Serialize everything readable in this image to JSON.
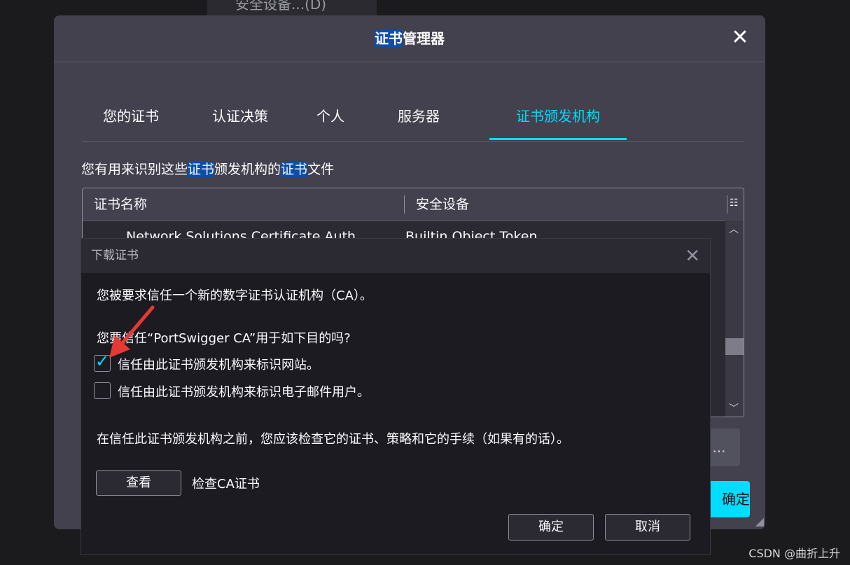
{
  "background": {
    "partial_menu_text": "安全设备...(D)"
  },
  "cert_manager": {
    "title_highlight": "证书",
    "title_rest": "管理器",
    "close_glyph": "✕",
    "tabs": [
      {
        "label": "您的证书"
      },
      {
        "label": "认证决策"
      },
      {
        "label": "个人"
      },
      {
        "label": "服务器"
      },
      {
        "label": "证书颁发机构",
        "active": true
      }
    ],
    "description": {
      "p1": "您有用来识别这些",
      "hl1": "证书",
      "p2": "颁发机构的",
      "hl2": "证书",
      "p3": "文件"
    },
    "columns": [
      "证书名称",
      "安全设备"
    ],
    "first_row": {
      "name": "Network Solutions Certificate Auth...",
      "device": "Builtin Object Token"
    },
    "partial_button_text": "...",
    "ok_partial": "确定"
  },
  "download_dialog": {
    "title": "下载证书",
    "close_glyph": "✕",
    "message": "您被要求信任一个新的数字证书认证机构（CA）。",
    "question": "您要信任“PortSwigger CA”用于如下目的吗?",
    "options": [
      {
        "label": "信任由此证书颁发机构来标识网站。",
        "checked": true
      },
      {
        "label": "信任由此证书颁发机构来标识电子邮件用户。",
        "checked": false
      }
    ],
    "advice": "在信任此证书颁发机构之前，您应该检查它的证书、策略和它的手续（如果有的话）。",
    "view_button": "查看",
    "view_label": "检查CA证书",
    "ok_button": "确定",
    "cancel_button": "取消"
  },
  "annotation_color": "#e53935",
  "watermark": "CSDN @曲折上升"
}
